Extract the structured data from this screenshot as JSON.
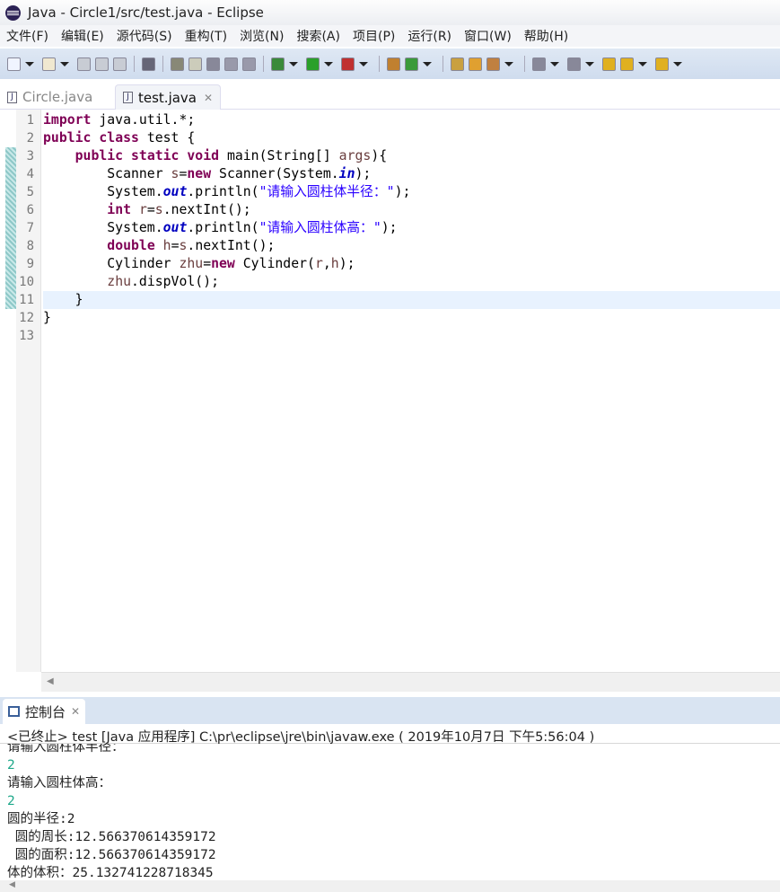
{
  "window": {
    "title": "Java  -  Circle1/src/test.java  -  Eclipse"
  },
  "menu": [
    "文件(F)",
    "编辑(E)",
    "源代码(S)",
    "重构(T)",
    "浏览(N)",
    "搜索(A)",
    "项目(P)",
    "运行(R)",
    "窗口(W)",
    "帮助(H)"
  ],
  "tabs": [
    {
      "label": "Circle.java",
      "active": false
    },
    {
      "label": "test.java",
      "active": true
    }
  ],
  "editor": {
    "current_line": 11,
    "lines": [
      [
        [
          "import",
          "kw"
        ],
        [
          " java.util.*;",
          ""
        ]
      ],
      [
        [
          "public",
          "kw"
        ],
        [
          " ",
          ""
        ],
        [
          "class",
          "kw"
        ],
        [
          " test {",
          ""
        ]
      ],
      [
        [
          "    ",
          ""
        ],
        [
          "public",
          "kw"
        ],
        [
          " ",
          ""
        ],
        [
          "static",
          "kw"
        ],
        [
          " ",
          ""
        ],
        [
          "void",
          "kw"
        ],
        [
          " main(String[] ",
          ""
        ],
        [
          "args",
          "var"
        ],
        [
          "){",
          ""
        ]
      ],
      [
        [
          "        Scanner ",
          ""
        ],
        [
          "s",
          "var"
        ],
        [
          "=",
          ""
        ],
        [
          "new",
          "kw"
        ],
        [
          " Scanner(System.",
          ""
        ],
        [
          "in",
          "fld"
        ],
        [
          ");",
          ""
        ]
      ],
      [
        [
          "        System.",
          ""
        ],
        [
          "out",
          "fld"
        ],
        [
          ".println(",
          ""
        ],
        [
          "\"请输入圆柱体半径：\"",
          "str"
        ],
        [
          ");",
          ""
        ]
      ],
      [
        [
          "        ",
          ""
        ],
        [
          "int",
          "kw"
        ],
        [
          " ",
          ""
        ],
        [
          "r",
          "var"
        ],
        [
          "=",
          ""
        ],
        [
          "s",
          "var"
        ],
        [
          ".nextInt();",
          ""
        ]
      ],
      [
        [
          "        System.",
          ""
        ],
        [
          "out",
          "fld"
        ],
        [
          ".println(",
          ""
        ],
        [
          "\"请输入圆柱体高：\"",
          "str"
        ],
        [
          ");",
          ""
        ]
      ],
      [
        [
          "        ",
          ""
        ],
        [
          "double",
          "kw"
        ],
        [
          " ",
          ""
        ],
        [
          "h",
          "var"
        ],
        [
          "=",
          ""
        ],
        [
          "s",
          "var"
        ],
        [
          ".nextInt();",
          ""
        ]
      ],
      [
        [
          "        Cylinder ",
          ""
        ],
        [
          "zhu",
          "var"
        ],
        [
          "=",
          ""
        ],
        [
          "new",
          "kw"
        ],
        [
          " Cylinder(",
          ""
        ],
        [
          "r",
          "var"
        ],
        [
          ",",
          ""
        ],
        [
          "h",
          "var"
        ],
        [
          ");",
          ""
        ]
      ],
      [
        [
          "        ",
          ""
        ],
        [
          "zhu",
          "var"
        ],
        [
          ".dispVol();",
          ""
        ]
      ],
      [
        [
          "    }",
          ""
        ]
      ],
      [
        [
          "}",
          ""
        ]
      ],
      []
    ]
  },
  "console": {
    "tab_label": "控制台",
    "header": "<已终止> test [Java 应用程序] C:\\pr\\eclipse\\jre\\bin\\javaw.exe ( 2019年10月7日 下午5:56:04 )",
    "output": [
      {
        "text": "请输入圆柱体半径：",
        "input": false
      },
      {
        "text": "2",
        "input": true
      },
      {
        "text": "请输入圆柱体高：",
        "input": false
      },
      {
        "text": "2",
        "input": true
      },
      {
        "text": "圆的半径:2",
        "input": false
      },
      {
        "text": " 圆的周长:12.566370614359172",
        "input": false
      },
      {
        "text": " 圆的面积:12.566370614359172",
        "input": false
      },
      {
        "text": "体的体积：25.132741228718345",
        "input": false
      }
    ]
  },
  "colors": {
    "keyword": "#7f0055",
    "string": "#2a00ff",
    "field": "#0000c0",
    "input": "#1fa88a"
  }
}
